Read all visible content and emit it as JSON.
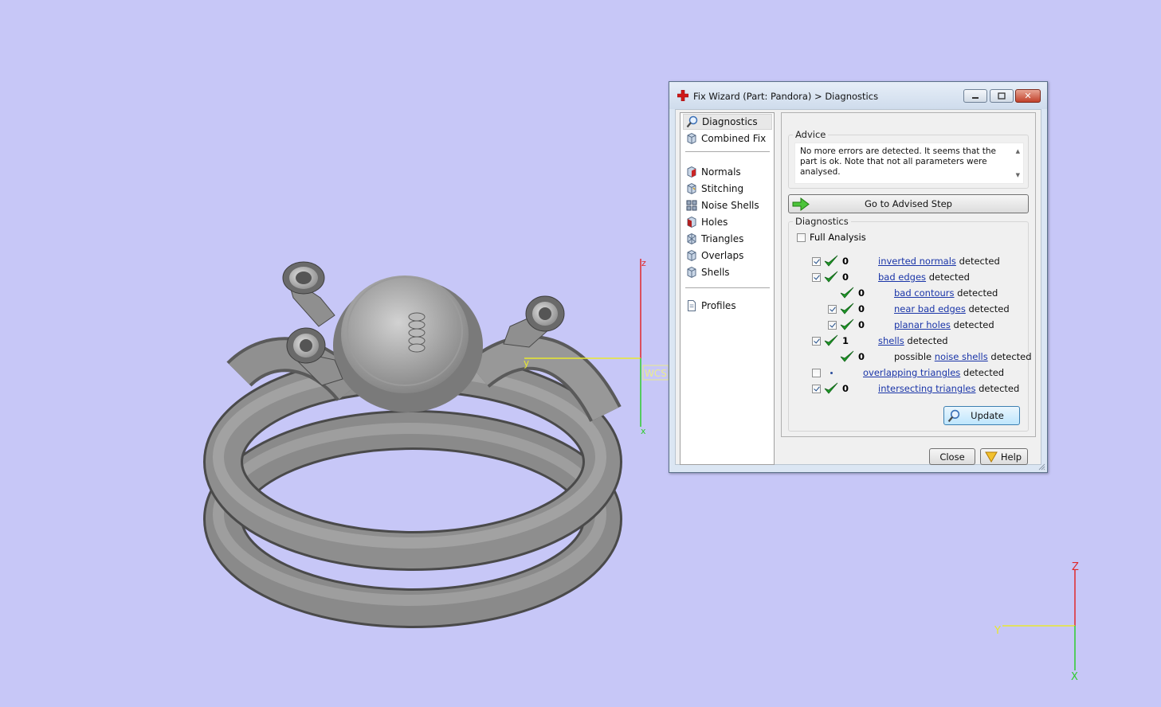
{
  "window": {
    "title": "Fix Wizard (Part: Pandora) > Diagnostics",
    "minimize_icon": "minimize-icon",
    "maximize_icon": "maximize-icon",
    "close_icon": "close-icon",
    "close_glyph": "✕"
  },
  "nav": {
    "items": [
      {
        "label": "Diagnostics",
        "icon": "magnifier-icon",
        "selected": true
      },
      {
        "label": "Combined Fix",
        "icon": "cube-icon"
      },
      {
        "label": "Normals",
        "icon": "normals-cube-icon"
      },
      {
        "label": "Stitching",
        "icon": "stitching-cube-icon"
      },
      {
        "label": "Noise Shells",
        "icon": "noise-shells-icon"
      },
      {
        "label": "Holes",
        "icon": "holes-cube-icon"
      },
      {
        "label": "Triangles",
        "icon": "triangles-cube-icon"
      },
      {
        "label": "Overlaps",
        "icon": "overlaps-cube-icon"
      },
      {
        "label": "Shells",
        "icon": "shells-cube-icon"
      },
      {
        "label": "Profiles",
        "icon": "document-icon"
      }
    ]
  },
  "advice": {
    "title": "Advice",
    "text": "No more errors are detected. It seems that the part is ok. Note that not all parameters were analysed.",
    "scroll_up": "▲",
    "scroll_down": "▼"
  },
  "advised_step_button": "Go to Advised Step",
  "diagnostics": {
    "title": "Diagnostics",
    "full_analysis_label": "Full Analysis",
    "full_analysis_checked": false,
    "rows": [
      {
        "checked": true,
        "ok": true,
        "count": "0",
        "prefix": "",
        "link": "inverted normals",
        "suffix": " detected"
      },
      {
        "checked": true,
        "ok": true,
        "count": "0",
        "prefix": "",
        "link": "bad edges",
        "suffix": " detected"
      },
      {
        "checked": null,
        "ok": true,
        "count": "0",
        "prefix": "",
        "link": "bad contours",
        "suffix": " detected"
      },
      {
        "checked": true,
        "ok": true,
        "count": "0",
        "prefix": "",
        "link": "near bad edges",
        "suffix": " detected"
      },
      {
        "checked": true,
        "ok": true,
        "count": "0",
        "prefix": "",
        "link": "planar holes",
        "suffix": " detected"
      },
      {
        "checked": true,
        "ok": true,
        "count": "1",
        "prefix": "",
        "link": "shells",
        "suffix": " detected"
      },
      {
        "checked": null,
        "ok": true,
        "count": "0",
        "prefix": "possible ",
        "link": "noise shells",
        "suffix": " detected"
      },
      {
        "checked": false,
        "ok": false,
        "count": "•",
        "prefix": "",
        "link": "overlapping triangles",
        "suffix": " detected"
      },
      {
        "checked": true,
        "ok": true,
        "count": "0",
        "prefix": "",
        "link": "intersecting triangles",
        "suffix": " detected"
      }
    ],
    "update_button": "Update"
  },
  "footer": {
    "close_button": "Close",
    "help_button": "Help"
  },
  "viewport": {
    "local_axes": {
      "z": "z",
      "y": "y",
      "x": "x",
      "tag": "WCS"
    },
    "world_axes": {
      "z": "Z",
      "y": "Y",
      "x": "X"
    },
    "colors": {
      "background": "#c7c7f7",
      "z_axis": "#e0282a",
      "y_axis": "#e8e830",
      "x_axis": "#2ecc2e",
      "model": "#7f7f7f"
    }
  }
}
